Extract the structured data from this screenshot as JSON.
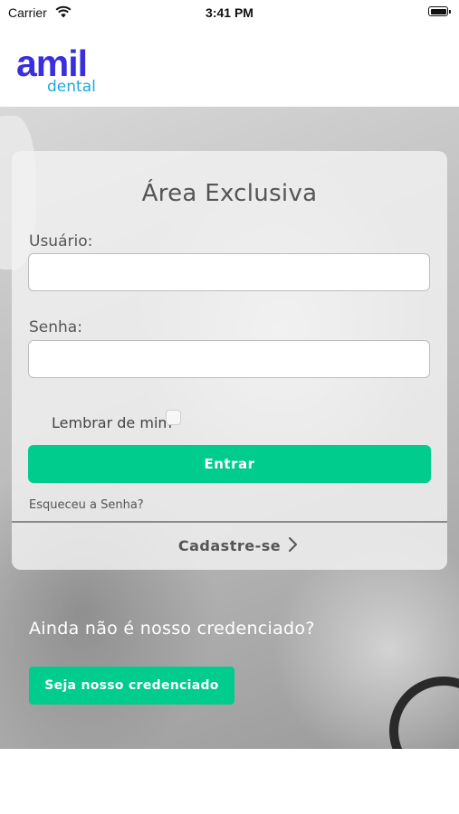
{
  "status_bar": {
    "carrier": "Carrier",
    "time": "3:41 PM"
  },
  "logo": {
    "brand": "amil",
    "product": "dental"
  },
  "login_card": {
    "title": "Área Exclusiva",
    "username_label": "Usuário:",
    "username_value": "",
    "password_label": "Senha:",
    "password_value": "",
    "remember_label": "Lembrar de mim",
    "remember_checked": false,
    "submit_label": "Entrar",
    "forgot_label": "Esqueceu a Senha?",
    "register_label": "Cadastre-se"
  },
  "cta": {
    "question": "Ainda não é nosso credenciado?",
    "button_label": "Seja nosso credenciado"
  },
  "colors": {
    "brand_blue": "#3a2fdf",
    "dental_blue": "#1aa8e0",
    "accent_green": "#00cc8e"
  }
}
